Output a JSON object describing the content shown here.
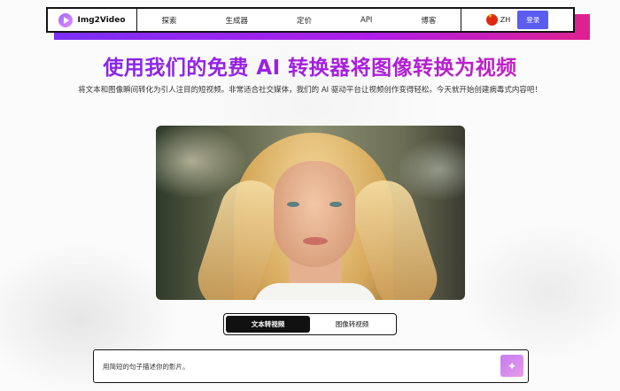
{
  "brand": {
    "name": "Img2Video",
    "logo_icon": "play-logo-icon"
  },
  "nav": {
    "items": [
      "探索",
      "生成器",
      "定价",
      "API",
      "博客"
    ],
    "language": "ZH",
    "login_label": "登录"
  },
  "hero": {
    "headline": "使用我们的免费 AI 转换器将图像转换为视频",
    "subtitle": "将文本和图像瞬间转化为引人注目的短视频。非常适合社交媒体，我们的 AI 驱动平台让视频创作变得轻松。今天就开始创建病毒式内容吧！",
    "image_alt": "portrait"
  },
  "mode_toggle": {
    "options": [
      "文本转视频",
      "图像转视频"
    ],
    "selected": "文本转视频"
  },
  "prompt": {
    "placeholder": "用简短的句子描述你的影片。",
    "generate_icon": "magic-wand-icon"
  },
  "colors": {
    "accent_start": "#7a2af0",
    "accent_end": "#d21fb6",
    "login_bg": "#5b5cf0",
    "border": "#141414"
  }
}
